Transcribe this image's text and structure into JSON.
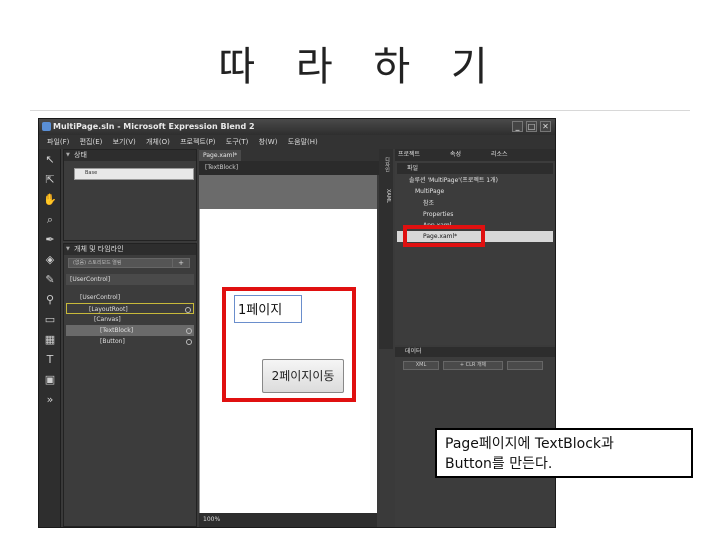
{
  "slide": {
    "title": "따 라 하 기",
    "caption_line1": "Page페이지에 TextBlock과",
    "caption_line2": "Button를 만든다."
  },
  "window": {
    "title": "MultiPage.sln - Microsoft Expression Blend 2",
    "controls": [
      "_",
      "□",
      "✕"
    ]
  },
  "menu": [
    "파일(F)",
    "편집(E)",
    "보기(V)",
    "개체(O)",
    "프로젝트(P)",
    "도구(T)",
    "창(W)",
    "도움말(H)"
  ],
  "left_panel": {
    "states_header": "상태",
    "state_item": "Base",
    "objects_header": "개체 및 타임라인",
    "search_placeholder": "(없음) 스토리보드 열림",
    "add_button": "+",
    "tree": [
      "[UserControl]",
      "[UserControl]",
      "[LayoutRoot]",
      "[Canvas]",
      "[TextBlock]",
      "[Button]"
    ]
  },
  "document": {
    "tab": "Page.xaml*",
    "breadcrumb": "[TextBlock]",
    "textblock_text": "1페이지",
    "button_text": "2페이지이동",
    "zoom": "100%"
  },
  "right_panel": {
    "header": "프로젝트",
    "tabs": [
      "속성",
      "리소스"
    ],
    "files_header": "파일",
    "items": [
      "솔루션 'MultiPage'(프로젝트 1개)",
      "MultiPage",
      "참조",
      "Properties",
      "App.xaml",
      "Page.xaml*"
    ],
    "data_header": "데이터",
    "data_buttons": [
      "XML",
      "+ CLR 개체",
      ""
    ]
  },
  "colors": {
    "highlight_red": "#e01010",
    "ui_dark": "#3a3a3a"
  }
}
